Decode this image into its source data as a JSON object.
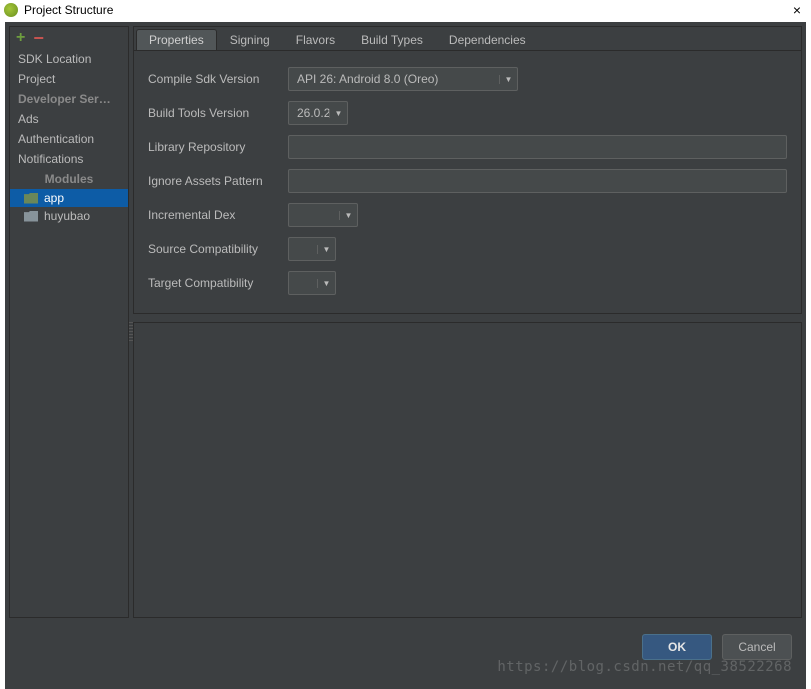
{
  "window": {
    "title": "Project Structure",
    "close_icon": "×"
  },
  "sidebar": {
    "items": [
      {
        "label": "SDK Location"
      },
      {
        "label": "Project"
      },
      {
        "label": "Developer Ser… …",
        "header": true
      },
      {
        "label": "Ads"
      },
      {
        "label": "Authentication"
      },
      {
        "label": "Notifications"
      }
    ],
    "section_label": "Modules",
    "modules": [
      {
        "label": "app",
        "selected": true
      },
      {
        "label": "huyubao",
        "selected": false
      }
    ]
  },
  "tabs": [
    {
      "label": "Properties",
      "active": true
    },
    {
      "label": "Signing"
    },
    {
      "label": "Flavors"
    },
    {
      "label": "Build Types"
    },
    {
      "label": "Dependencies"
    }
  ],
  "form": {
    "compile_sdk": {
      "label": "Compile Sdk Version",
      "value": "API 26: Android 8.0 (Oreo)"
    },
    "build_tools": {
      "label": "Build Tools Version",
      "value": "26.0.2"
    },
    "library_repo": {
      "label": "Library Repository",
      "value": ""
    },
    "ignore_assets": {
      "label": "Ignore Assets Pattern",
      "value": ""
    },
    "incremental_dex": {
      "label": "Incremental Dex",
      "value": ""
    },
    "source_compat": {
      "label": "Source Compatibility",
      "value": ""
    },
    "target_compat": {
      "label": "Target Compatibility",
      "value": ""
    }
  },
  "buttons": {
    "ok": "OK",
    "cancel": "Cancel"
  },
  "watermark": "https://blog.csdn.net/qq_38522268"
}
